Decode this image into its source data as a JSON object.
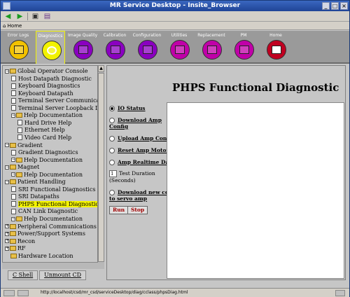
{
  "window": {
    "title": "MR Service Desktop - Insite_Browser"
  },
  "addrbar": {
    "home_label": "Home"
  },
  "navtabs": [
    {
      "label": "Error Logs",
      "color": "#f2c200"
    },
    {
      "label": "Diagnostics",
      "color": "#f2f200"
    },
    {
      "label": "Image Quality",
      "color": "#8a00c0"
    },
    {
      "label": "Calibration",
      "color": "#8a00c0"
    },
    {
      "label": "Configuration",
      "color": "#8a00c0"
    },
    {
      "label": "Utilities",
      "color": "#c000a8"
    },
    {
      "label": "Replacement",
      "color": "#c000a8"
    },
    {
      "label": "PM",
      "color": "#c000a8"
    },
    {
      "label": "Home",
      "color": "#c00020"
    }
  ],
  "tree": [
    {
      "label": "Global Operator Console",
      "kind": "folder",
      "level": 0
    },
    {
      "label": "Host Datapath Diagnostic",
      "kind": "doc",
      "level": 1
    },
    {
      "label": "Keyboard Diagnostics",
      "kind": "doc",
      "level": 1
    },
    {
      "label": "Keyboard Datapath",
      "kind": "doc",
      "level": 1
    },
    {
      "label": "Terminal Server Communications",
      "kind": "doc",
      "level": 1
    },
    {
      "label": "Terminal Server Loopback Diagnostic",
      "kind": "doc",
      "level": 1
    },
    {
      "label": "Help Documentation",
      "kind": "folder",
      "level": 1
    },
    {
      "label": "Hard Drive Help",
      "kind": "doc",
      "level": 2
    },
    {
      "label": "Ethernet Help",
      "kind": "doc",
      "level": 2
    },
    {
      "label": "Video Card Help",
      "kind": "doc",
      "level": 2
    },
    {
      "label": "Gradient",
      "kind": "folder",
      "level": 0
    },
    {
      "label": "Gradient Diagnostics",
      "kind": "doc",
      "level": 1
    },
    {
      "label": "Help Documentation",
      "kind": "folder",
      "level": 1
    },
    {
      "label": "Magnet",
      "kind": "folder",
      "level": 0
    },
    {
      "label": "Help Documentation",
      "kind": "folder",
      "level": 1
    },
    {
      "label": "Patient Handling",
      "kind": "folder",
      "level": 0
    },
    {
      "label": "SRI Functional Diagnostics",
      "kind": "doc",
      "level": 1
    },
    {
      "label": "SRI Datapaths",
      "kind": "doc",
      "level": 1
    },
    {
      "label": "PHPS Functional Diagnostics",
      "kind": "doc",
      "level": 1,
      "selected": true
    },
    {
      "label": "CAN Link Diagnostic",
      "kind": "doc",
      "level": 1
    },
    {
      "label": "Help Documentation",
      "kind": "folder",
      "level": 1
    },
    {
      "label": "Peripheral Communications",
      "kind": "folder",
      "level": 0
    },
    {
      "label": "Power/Support Systems",
      "kind": "folder",
      "level": 0
    },
    {
      "label": "Recon",
      "kind": "folder",
      "level": 0
    },
    {
      "label": "RF",
      "kind": "folder",
      "level": 0
    },
    {
      "label": "Hardware Location",
      "kind": "folder-noexp",
      "level": 0
    }
  ],
  "bottom_tabs": {
    "shell": "C Shell",
    "unmount": "Unmount CD"
  },
  "main": {
    "title": "PHPS Functional Diagnostic",
    "options": {
      "io_status": "IO Status",
      "download_amp_1": "Download Amp",
      "download_amp_2": "Config",
      "upload_amp": "Upload Amp Config",
      "reset_amp": "Reset Amp Motor",
      "amp_realtime": "Amp Realtime Data",
      "download_code_1": "Download new code",
      "download_code_2": "to servo amp"
    },
    "duration": {
      "value": "1",
      "label_1": "Test Duration",
      "label_2": "(Seconds)"
    },
    "run_label": "Run",
    "stop_label": "Stop"
  },
  "status": {
    "url": "http://localhost/csd/mr_csd/serviceDesktop/diag/cclass/phpsDiag.html"
  }
}
